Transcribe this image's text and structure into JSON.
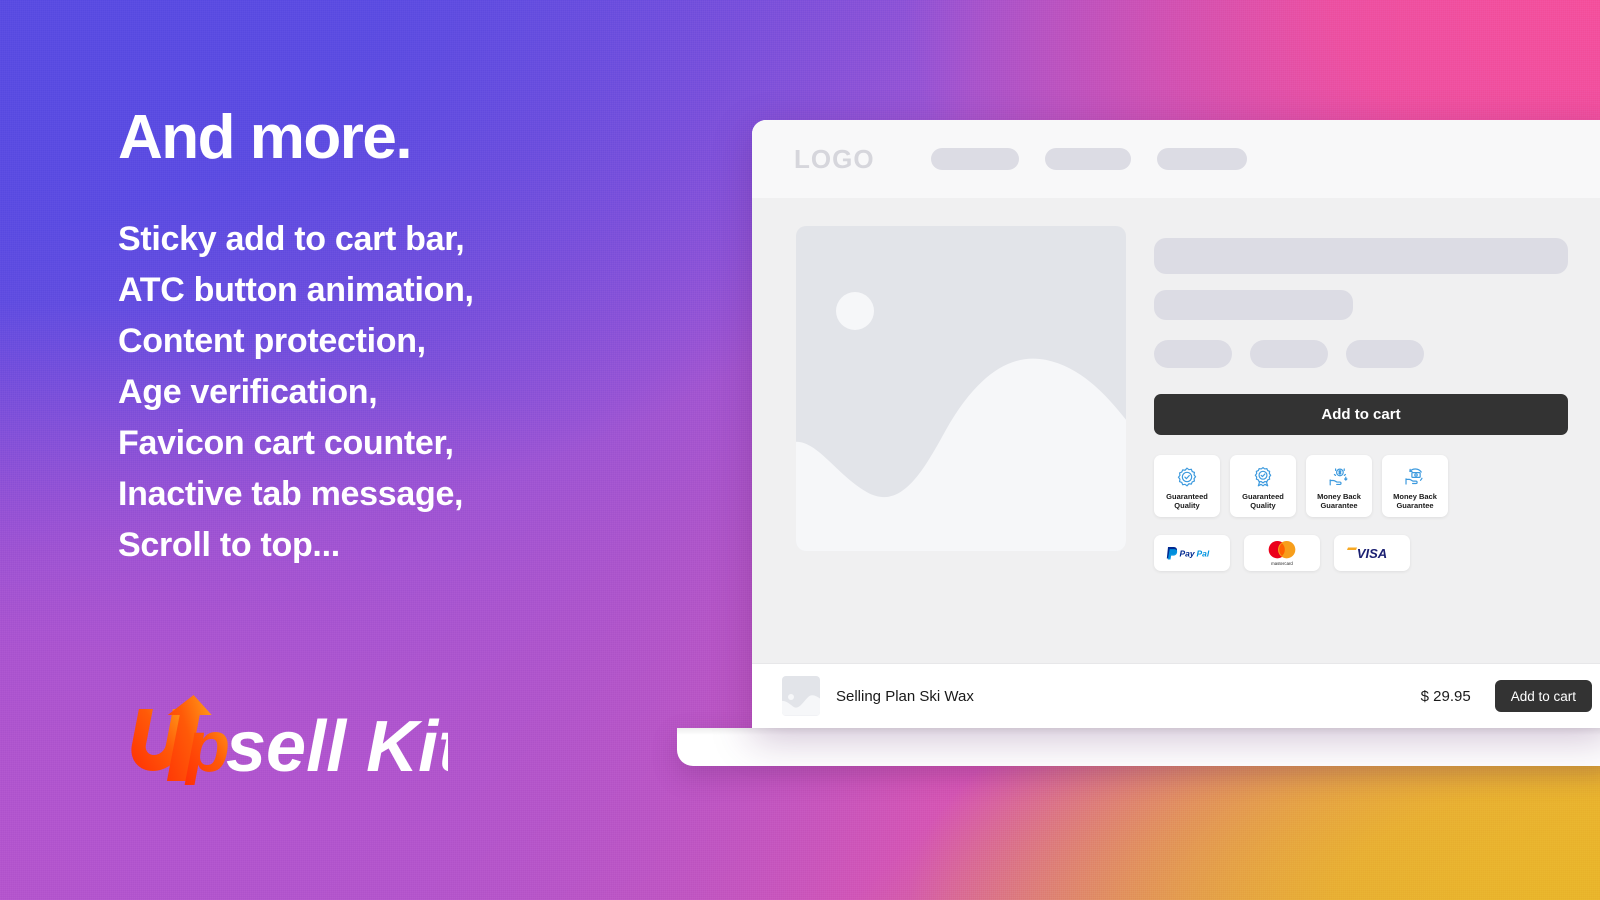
{
  "hero": {
    "headline": "And more.",
    "features": [
      "Sticky add to cart bar,",
      "ATC button animation,",
      "Content protection,",
      "Age verification,",
      "Favicon cart counter,",
      "Inactive tab message,",
      "Scroll to top..."
    ]
  },
  "brand": {
    "name_part1": "Up",
    "name_part2": "sell Kit",
    "full_name": "Upsell Kit",
    "accent_color": "#ff3d0f",
    "accent_color_2": "#ff9a1f"
  },
  "mockup": {
    "header": {
      "logo_text": "LOGO",
      "nav_placeholders": 3
    },
    "product": {
      "image_alt": "product-image-placeholder",
      "title_placeholder": "",
      "add_to_cart_label": "Add to cart"
    },
    "trust_badges": [
      {
        "icon": "seal-check-icon",
        "label": "Guaranteed\nQuality",
        "line1": "Guaranteed",
        "line2": "Quality"
      },
      {
        "icon": "award-ribbon-check-icon",
        "label": "Guaranteed\nQuality",
        "line1": "Guaranteed",
        "line2": "Quality"
      },
      {
        "icon": "hand-dollar-coin-icon",
        "label": "Money Back\nGuarantee",
        "line1": "Money Back",
        "line2": "Guarantee"
      },
      {
        "icon": "hand-banknote-return-icon",
        "label": "Money Back\nGuarantee",
        "line1": "Money Back",
        "line2": "Guarantee"
      }
    ],
    "payments": [
      {
        "icon": "paypal-icon",
        "name": "PayPal"
      },
      {
        "icon": "mastercard-icon",
        "name": "mastercard"
      },
      {
        "icon": "visa-icon",
        "name": "VISA"
      }
    ],
    "scroll_top": {
      "icon": "arrow-up-circle-icon",
      "color": "#2b3a50"
    },
    "sticky_bar": {
      "product_name": "Selling Plan Ski Wax",
      "price": "$ 29.95",
      "add_to_cart_label": "Add to cart"
    }
  },
  "theme": {
    "gradient_top_left": "#5a4ce2",
    "gradient_top_right": "#f4509d",
    "gradient_bottom_left": "#b455cd",
    "gradient_bottom_right": "#e9b52c",
    "dark_button": "#333333",
    "badge_icon_blue": "#3d9ade"
  }
}
